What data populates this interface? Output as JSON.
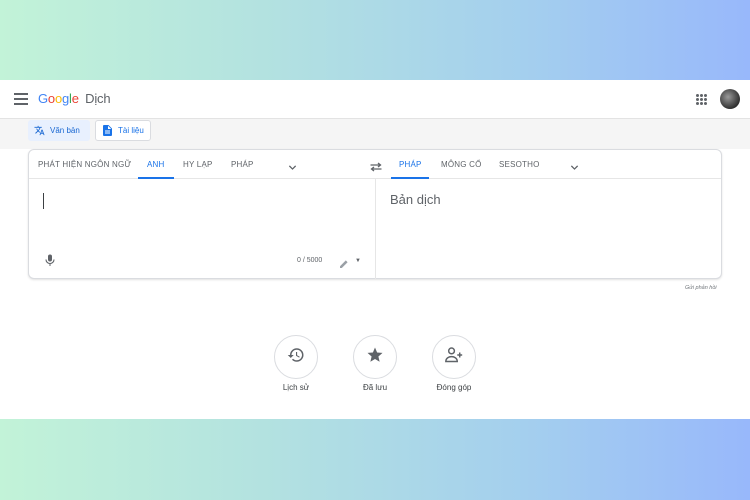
{
  "header": {
    "logo": [
      "G",
      "o",
      "o",
      "g",
      "l",
      "e"
    ],
    "logo_colors": [
      "#4285f4",
      "#ea4335",
      "#fbbc05",
      "#4285f4",
      "#34a853",
      "#ea4335"
    ],
    "product": "Dịch"
  },
  "modes": {
    "text": "Văn bản",
    "documents": "Tài liệu"
  },
  "source_langs": {
    "detect": "PHÁT HIỆN NGÔN NGỮ",
    "l1": "ANH",
    "l2": "HY LẠP",
    "l3": "PHÁP"
  },
  "target_langs": {
    "l1": "PHÁP",
    "l2": "MÔNG CỔ",
    "l3": "SESOTHO"
  },
  "source": {
    "counter": "0 / 5000"
  },
  "target": {
    "placeholder": "Bản dịch"
  },
  "feedback": "Gửi phản hồi",
  "actions": {
    "history": "Lịch sử",
    "saved": "Đã lưu",
    "contribute": "Đóng góp"
  },
  "colors": {
    "accent": "#1a73e8",
    "icon": "#5f6368"
  }
}
